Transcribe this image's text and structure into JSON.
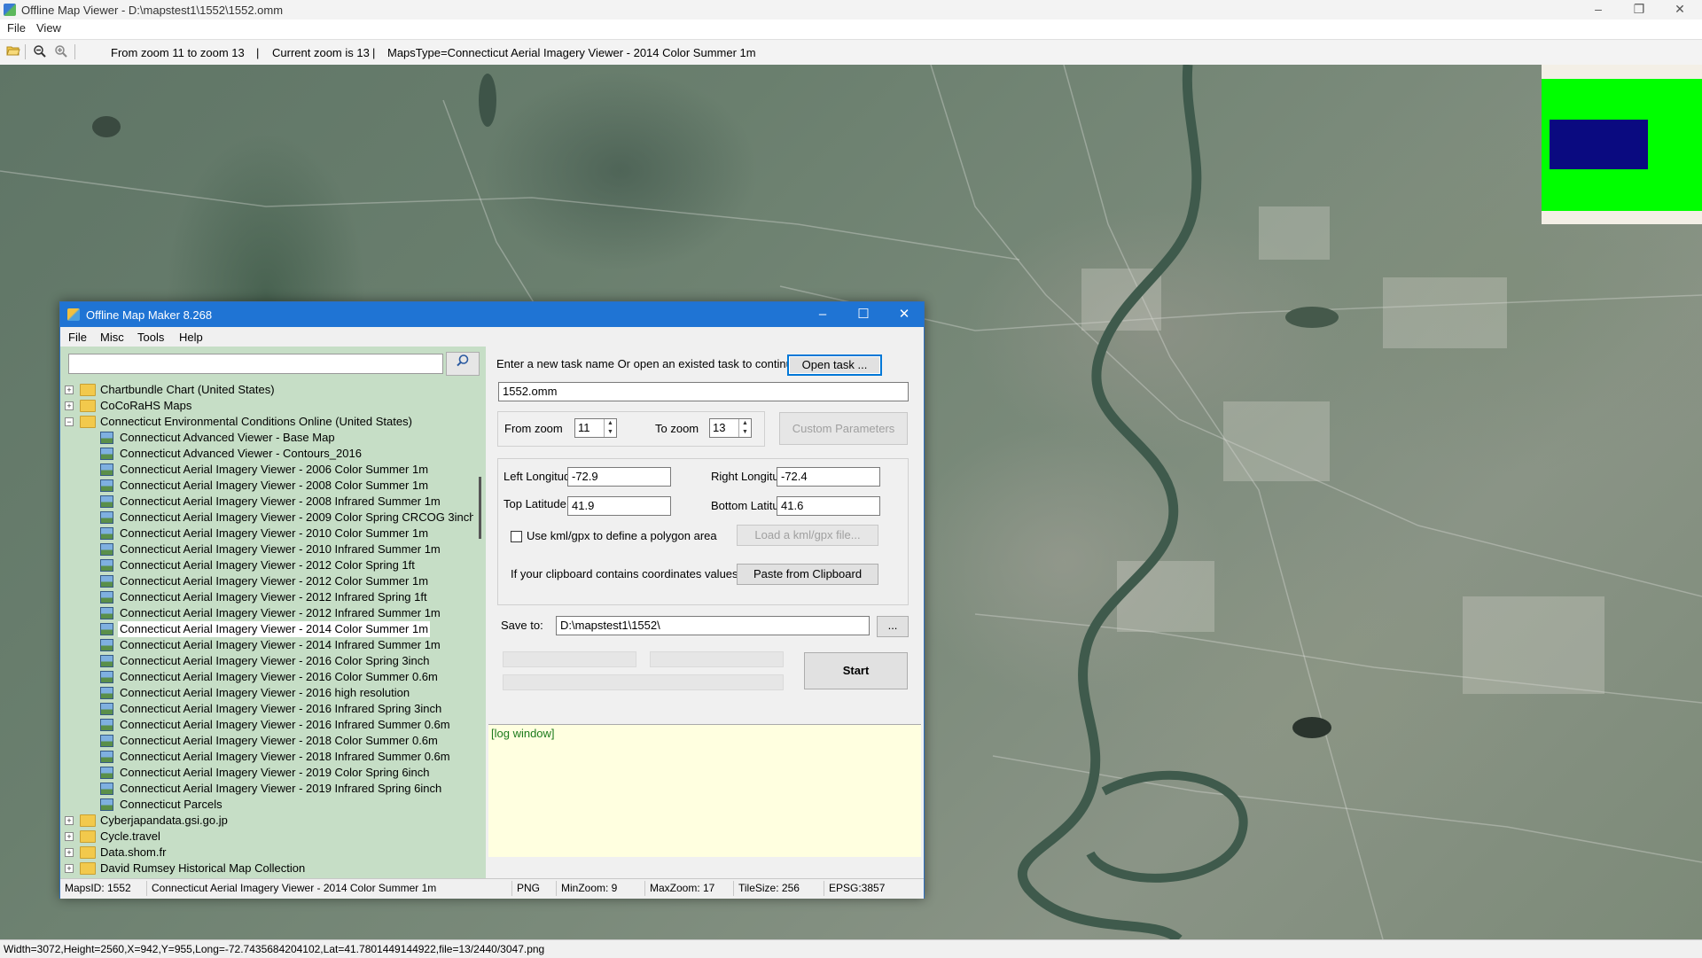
{
  "window": {
    "title": "Offline Map Viewer - D:\\mapstest1\\1552\\1552.omm",
    "controls": {
      "minimize": "–",
      "maximize": "❐",
      "close": "✕"
    }
  },
  "menu": {
    "file": "File",
    "view": "View"
  },
  "toolbar": {
    "open_icon": "folder-open-icon",
    "zoom_out_icon": "zoom-out-icon",
    "zoom_in_icon": "zoom-in-icon",
    "zoom_range": "From zoom 11 to zoom 13",
    "sep1": "|",
    "current_zoom": "Current zoom is 13",
    "sep2": "|",
    "maps_type": "MapsType=Connecticut Aerial Imagery Viewer - 2014 Color Summer 1m"
  },
  "statusbar": {
    "text": "Width=3072,Height=2560,X=942,Y=955,Long=-72.7435684204102,Lat=41.7801449144922,file=13/2440/3047.png"
  },
  "colors": {
    "minimap_green": "#00ff00",
    "minimap_blue": "#0a0a80",
    "titlebar_blue": "#1f74d4",
    "tree_bg": "#c6dec6",
    "log_bg": "#ffffe0"
  },
  "dialog": {
    "title": "Offline Map Maker 8.268",
    "controls": {
      "minimize": "–",
      "maximize": "☐",
      "close": "✕"
    },
    "menu": {
      "file": "File",
      "misc": "Misc",
      "tools": "Tools",
      "help": "Help"
    },
    "search": {
      "value": "",
      "button_icon": "search-icon",
      "button_glyph": "⌕"
    },
    "tree": [
      {
        "level": 0,
        "kind": "folder",
        "expander": "+",
        "label": "Chartbundle Chart (United States)"
      },
      {
        "level": 0,
        "kind": "folder",
        "expander": "+",
        "label": "CoCoRaHS Maps"
      },
      {
        "level": 0,
        "kind": "folder-open",
        "expander": "−",
        "label": "Connecticut Environmental Conditions Online (United States)"
      },
      {
        "level": 1,
        "kind": "map",
        "label": "Connecticut Advanced Viewer - Base Map"
      },
      {
        "level": 1,
        "kind": "map",
        "label": "Connecticut Advanced Viewer - Contours_2016"
      },
      {
        "level": 1,
        "kind": "map",
        "label": "Connecticut Aerial Imagery Viewer - 2006 Color Summer 1m"
      },
      {
        "level": 1,
        "kind": "map",
        "label": "Connecticut Aerial Imagery Viewer - 2008 Color Summer 1m"
      },
      {
        "level": 1,
        "kind": "map",
        "label": "Connecticut Aerial Imagery Viewer - 2008 Infrared Summer 1m"
      },
      {
        "level": 1,
        "kind": "map",
        "label": "Connecticut Aerial Imagery Viewer - 2009 Color Spring CRCOG 3inch"
      },
      {
        "level": 1,
        "kind": "map",
        "label": "Connecticut Aerial Imagery Viewer - 2010 Color Summer 1m"
      },
      {
        "level": 1,
        "kind": "map",
        "label": "Connecticut Aerial Imagery Viewer - 2010 Infrared Summer 1m"
      },
      {
        "level": 1,
        "kind": "map",
        "label": "Connecticut Aerial Imagery Viewer - 2012 Color Spring 1ft"
      },
      {
        "level": 1,
        "kind": "map",
        "label": "Connecticut Aerial Imagery Viewer - 2012 Color Summer 1m"
      },
      {
        "level": 1,
        "kind": "map",
        "label": "Connecticut Aerial Imagery Viewer - 2012 Infrared Spring 1ft"
      },
      {
        "level": 1,
        "kind": "map",
        "label": "Connecticut Aerial Imagery Viewer - 2012 Infrared Summer 1m"
      },
      {
        "level": 1,
        "kind": "map",
        "label": "Connecticut Aerial Imagery Viewer - 2014 Color Summer 1m",
        "selected": true
      },
      {
        "level": 1,
        "kind": "map",
        "label": "Connecticut Aerial Imagery Viewer - 2014 Infrared Summer 1m"
      },
      {
        "level": 1,
        "kind": "map",
        "label": "Connecticut Aerial Imagery Viewer - 2016 Color Spring 3inch"
      },
      {
        "level": 1,
        "kind": "map",
        "label": "Connecticut Aerial Imagery Viewer - 2016 Color Summer 0.6m"
      },
      {
        "level": 1,
        "kind": "map",
        "label": "Connecticut Aerial Imagery Viewer - 2016 high resolution"
      },
      {
        "level": 1,
        "kind": "map",
        "label": "Connecticut Aerial Imagery Viewer - 2016 Infrared Spring 3inch"
      },
      {
        "level": 1,
        "kind": "map",
        "label": "Connecticut Aerial Imagery Viewer - 2016 Infrared Summer 0.6m"
      },
      {
        "level": 1,
        "kind": "map",
        "label": "Connecticut Aerial Imagery Viewer - 2018 Color Summer 0.6m"
      },
      {
        "level": 1,
        "kind": "map",
        "label": "Connecticut Aerial Imagery Viewer - 2018 Infrared Summer 0.6m"
      },
      {
        "level": 1,
        "kind": "map",
        "label": "Connecticut Aerial Imagery Viewer - 2019 Color Spring 6inch"
      },
      {
        "level": 1,
        "kind": "map",
        "label": "Connecticut Aerial Imagery Viewer - 2019 Infrared Spring 6inch"
      },
      {
        "level": 1,
        "kind": "map",
        "label": "Connecticut Parcels"
      },
      {
        "level": 0,
        "kind": "folder",
        "expander": "+",
        "label": "Cyberjapandata.gsi.go.jp"
      },
      {
        "level": 0,
        "kind": "folder",
        "expander": "+",
        "label": "Cycle.travel"
      },
      {
        "level": 0,
        "kind": "folder",
        "expander": "+",
        "label": "Data.shom.fr"
      },
      {
        "level": 0,
        "kind": "folder",
        "expander": "+",
        "label": "David Rumsey Historical Map Collection"
      }
    ],
    "task": {
      "prompt": "Enter a new task name Or open an existed task to continue:",
      "open_button": "Open task ...",
      "name_value": "1552.omm"
    },
    "zoom": {
      "from_label": "From zoom",
      "from_value": "11",
      "to_label": "To zoom",
      "to_value": "13",
      "custom_params_button": "Custom Parameters"
    },
    "coords": {
      "left_lon_label": "Left Longitude",
      "left_lon_value": "-72.9",
      "right_lon_label": "Right Longitude",
      "right_lon_value": "-72.4",
      "top_lat_label": "Top Latitude",
      "top_lat_value": "41.9",
      "bottom_lat_label": "Bottom Latitude",
      "bottom_lat_value": "41.6",
      "kml_checkbox_label": "Use kml/gpx to define a polygon area",
      "kml_checked": false,
      "load_kml_button": "Load a kml/gpx file...",
      "clipboard_label": "If your clipboard contains coordinates values:",
      "paste_button": "Paste from Clipboard"
    },
    "save": {
      "label": "Save to:",
      "value": "D:\\mapstest1\\1552\\",
      "browse_button": "...",
      "start_button": "Start"
    },
    "progress": {
      "bar1": 0,
      "bar2": 0,
      "bar3": 0
    },
    "log": {
      "text": "[log window]"
    },
    "status": {
      "maps_id": "MapsID: 1552",
      "maps_name": "Connecticut Aerial Imagery Viewer - 2014 Color Summer 1m",
      "format": "PNG",
      "min_zoom": "MinZoom: 9",
      "max_zoom": "MaxZoom: 17",
      "tile_size": "TileSize: 256",
      "epsg": "EPSG:3857"
    }
  }
}
